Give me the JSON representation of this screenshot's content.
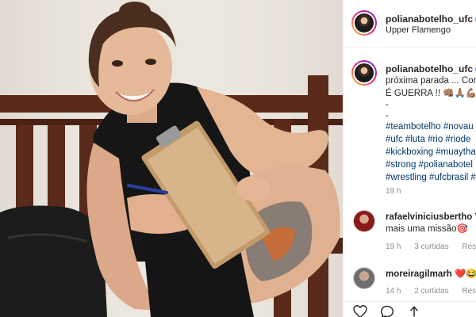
{
  "post": {
    "username": "polianabotelho_ufc",
    "location": "Upper Flamengo",
    "caption_lines": [
      "próxima parada ... Con",
      "É GUERRA !! 👊🏽🙏🏽💪🏽",
      "-",
      "-"
    ],
    "hashtag_lines": [
      "#teambotelho #novau",
      "#ufc #luta #rio #riode",
      "#kickboxing #muaytha",
      "#strong #polianabotel",
      "#wrestling #ufcbrasil #"
    ],
    "time_ago": "19 h"
  },
  "comments": [
    {
      "username": "rafaelviniciusbertho",
      "text_after_name": "V",
      "text_line2": "mais uma missão🎯",
      "time": "19 h",
      "replies": "3 curtidas",
      "reply_label": "Respo"
    },
    {
      "username": "moreiragilmarh",
      "text_after_name": "❤️😂",
      "time": "14 h",
      "replies": "2 curtidas",
      "reply_label": "Respo"
    }
  ],
  "icons": {
    "like": "heart-icon",
    "comment": "comment-icon",
    "share": "share-icon",
    "verified": "verified-badge-icon"
  },
  "colors": {
    "hashtag": "#00376b",
    "meta": "#8e8e8e",
    "verified": "#3897f0",
    "border": "#efefef"
  }
}
